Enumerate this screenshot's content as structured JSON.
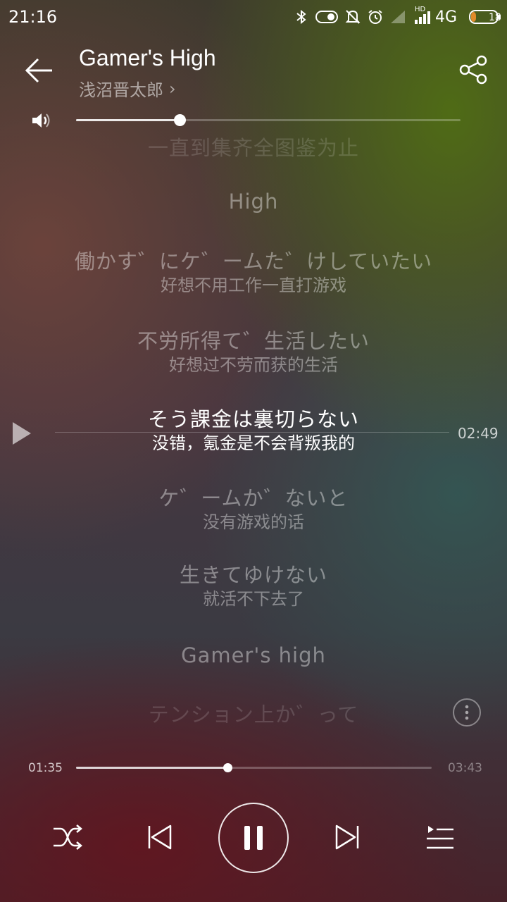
{
  "status_bar": {
    "time": "21:16",
    "network": "4G",
    "hd_label": "HD",
    "battery": "18",
    "icons": [
      "bluetooth-icon",
      "toggle-icon",
      "mute-icon",
      "alarm-icon",
      "signal-icon",
      "signal-icon",
      "battery-icon"
    ]
  },
  "header": {
    "title": "Gamer's High",
    "artist": "浅沼晋太郎",
    "artist_chevron": "›"
  },
  "volume": {
    "level": 0.27
  },
  "lyrics": {
    "lines": [
      {
        "jp": "一直到集齐全图鉴为止",
        "cn": "",
        "state": "fade"
      },
      {
        "jp": "High",
        "cn": "",
        "state": "dim"
      },
      {
        "jp": "働かす゛にケ゛ームた゛けしていたい",
        "cn": "好想不用工作一直打游戏",
        "state": "dim"
      },
      {
        "jp": "不労所得て゛生活したい",
        "cn": "好想过不劳而获的生活",
        "state": "dim"
      },
      {
        "jp": "そう課金は裏切らない",
        "cn": "没错，氪金是不会背叛我的",
        "state": "cur"
      },
      {
        "jp": "ケ゛ームか゛ないと",
        "cn": "没有游戏的话",
        "state": "dim"
      },
      {
        "jp": "生きてゆけない",
        "cn": "就活不下去了",
        "state": "dim"
      },
      {
        "jp": "Gamer's high",
        "cn": "",
        "state": "dim"
      },
      {
        "jp": "テンション上か゛って",
        "cn": "",
        "state": "fade"
      }
    ],
    "seek_time": "02:49"
  },
  "progress": {
    "current": "01:35",
    "total": "03:43",
    "fraction": 0.426
  },
  "colors": {
    "accent": "#ffffff"
  }
}
